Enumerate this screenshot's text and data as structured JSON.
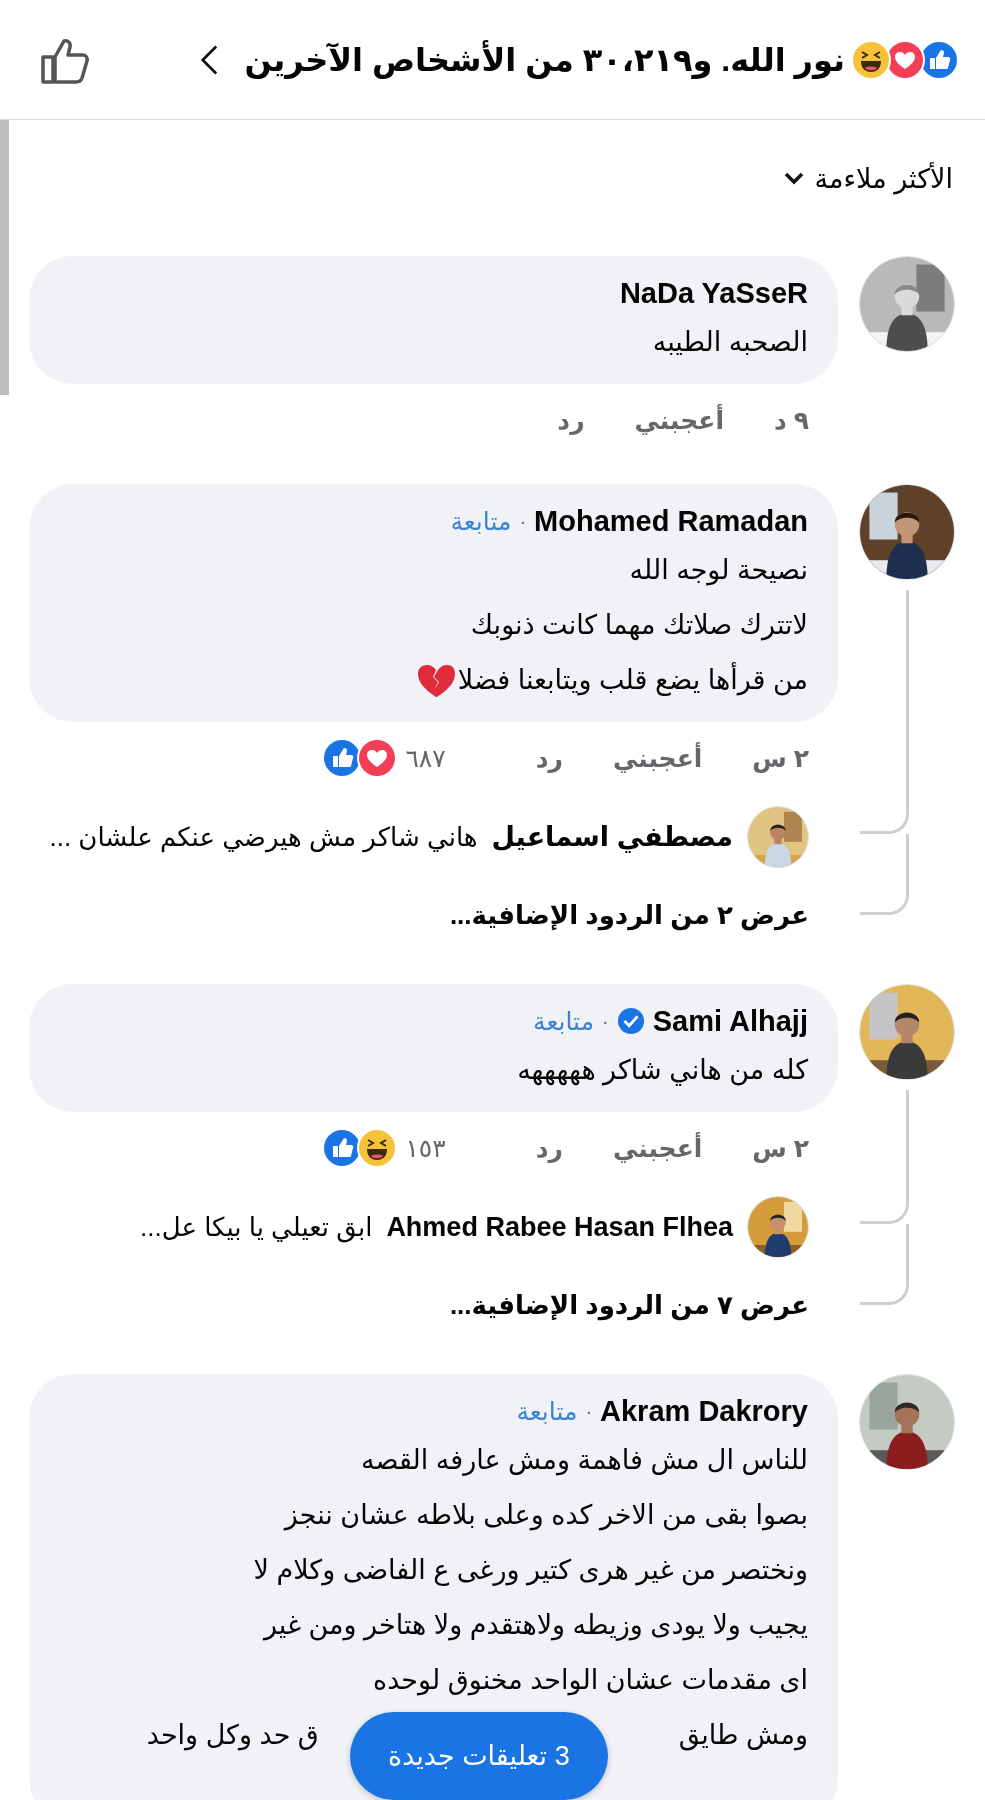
{
  "header": {
    "reactions": [
      {
        "kind": "like"
      },
      {
        "kind": "love"
      },
      {
        "kind": "haha"
      }
    ],
    "title": "نور الله. و٣٠،٢١٩ من الأشخاص الآخرين"
  },
  "sort": {
    "label": "الأكثر ملاءمة"
  },
  "comments": [
    {
      "author": "NaDa YaSseR",
      "verified": false,
      "lines": [
        "الصحبه الطيبه"
      ],
      "time": "٩ د",
      "like": "أعجبني",
      "reply": "رد"
    },
    {
      "author": "Mohamed Ramadan",
      "verified": false,
      "follow_separator": "·",
      "follow": "متابعة",
      "lines": [
        "نصيحة لوجه الله",
        "لاتترك صلاتك مهما كانت ذنوبك",
        "من قرأها يضع قلب ويتابعنا فضلا"
      ],
      "trailing_emoji": {
        "kind": "broken-heart"
      },
      "time": "٢ س",
      "like": "أعجبني",
      "reply": "رد",
      "reaction_count": "٦٨٧",
      "reactions": [
        {
          "kind": "like"
        },
        {
          "kind": "love"
        }
      ],
      "replies": [
        {
          "author": "مصطفي اسماعيل",
          "text": "هاني شاكر مش هيرضي عنكم علشان ..."
        }
      ],
      "more_replies": "عرض ٢ من الردود الإضافية..."
    },
    {
      "author": "Sami Alhajj",
      "verified": true,
      "follow_separator": "·",
      "follow": "متابعة",
      "lines": [
        "كله من هاني شاكر هههههه"
      ],
      "time": "٢ س",
      "like": "أعجبني",
      "reply": "رد",
      "reaction_count": "١٥٣",
      "reactions": [
        {
          "kind": "like"
        },
        {
          "kind": "haha"
        }
      ],
      "replies": [
        {
          "author": "Ahmed Rabee Hasan Flhea",
          "text": "ابق تعيلي يا بيكا عل..."
        }
      ],
      "more_replies": "عرض ٧ من الردود الإضافية..."
    },
    {
      "author": "Akram Dakrory",
      "verified": false,
      "follow_separator": "·",
      "follow": "متابعة",
      "lines": [
        "للناس ال مش فاهمة ومش عارفه القصه",
        "بصوا بقى من الاخر كده وعلى بلاطه عشان ننجز",
        "ونختصر من غير هرى كتير ورغى ع الفاضى وكلام لا",
        "يجيب ولا يودى وزيطه ولاهتقدم ولا هتاخر ومن غير",
        "اى مقدمات عشان الواحد مخنوق لوحده"
      ],
      "covered_line": {
        "start": "ومش طايق",
        "end": "ق حد وكل واحد"
      }
    }
  ],
  "new_comments_button": {
    "label": "3 تعليقات جديدة"
  }
}
